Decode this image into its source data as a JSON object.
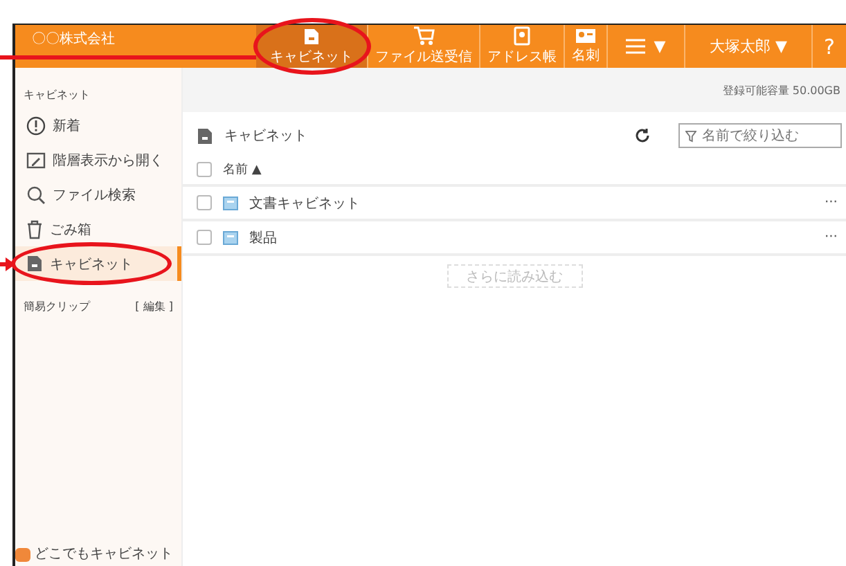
{
  "header": {
    "company": "〇〇株式会社",
    "nav": [
      {
        "kind": "cabinet",
        "label": "キャビネット",
        "selected": true
      },
      {
        "kind": "transfer",
        "label": "ファイル送受信",
        "selected": false
      },
      {
        "kind": "address",
        "label": "アドレス帳",
        "selected": false
      },
      {
        "kind": "card",
        "label": "名刺",
        "selected": false
      }
    ],
    "menu_caret": "▼",
    "user": "大塚太郎 ▼",
    "help": "?"
  },
  "sidebar": {
    "section": "キャビネット",
    "items": [
      {
        "kind": "alert",
        "label": "新着",
        "selected": false
      },
      {
        "kind": "tree",
        "label": "階層表示から開く",
        "selected": false
      },
      {
        "kind": "search",
        "label": "ファイル検索",
        "selected": false
      },
      {
        "kind": "trash",
        "label": "ごみ箱",
        "selected": false
      },
      {
        "kind": "cabinet",
        "label": "キャビネット",
        "selected": true
      }
    ],
    "clip_label": "簡易クリップ",
    "clip_edit": "[ 編集 ]",
    "footer": "どこでもキャビネット"
  },
  "storage": "登録可能容量 50.00GB",
  "main": {
    "title": "キャビネット",
    "filter": {
      "placeholder": "名前で絞り込む"
    },
    "select_all": {
      "checked": false
    },
    "column": "名前 ▲",
    "rows": [
      {
        "name": "文書キャビネット",
        "checked": false,
        "more": "···"
      },
      {
        "name": "製品",
        "checked": false,
        "more": "···"
      }
    ],
    "load_more": "さらに読み込む"
  }
}
